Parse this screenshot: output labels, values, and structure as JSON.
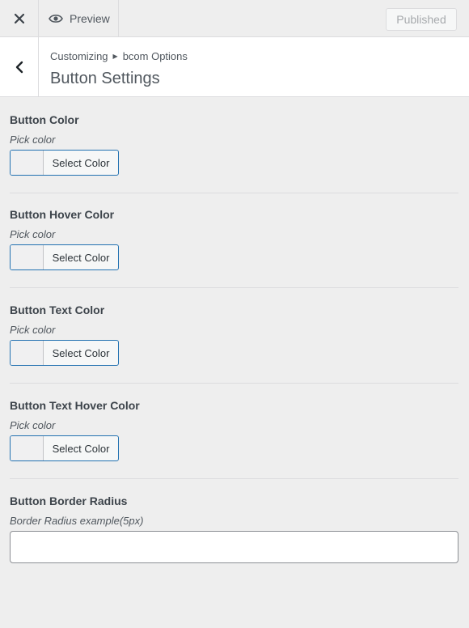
{
  "topbar": {
    "close_icon": "close-icon",
    "preview_label": "Preview",
    "published_label": "Published"
  },
  "header": {
    "breadcrumb_root": "Customizing",
    "breadcrumb_section": "bcom Options",
    "title": "Button Settings"
  },
  "sections": [
    {
      "title": "Button Color",
      "desc": "Pick color",
      "button_label": "Select Color"
    },
    {
      "title": "Button Hover Color",
      "desc": "Pick color",
      "button_label": "Select Color"
    },
    {
      "title": "Button Text Color",
      "desc": "Pick color",
      "button_label": "Select Color"
    },
    {
      "title": "Button Text Hover Color",
      "desc": "Pick color",
      "button_label": "Select Color"
    }
  ],
  "radius": {
    "title": "Button Border Radius",
    "desc": "Border Radius example(5px)",
    "value": ""
  },
  "colors": {
    "accent": "#2271b1",
    "background": "#eeeeee"
  }
}
